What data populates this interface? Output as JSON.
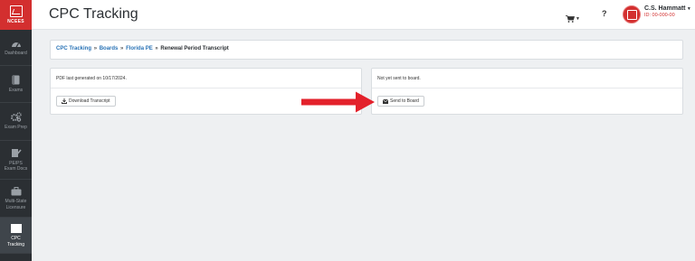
{
  "sidebar": {
    "logo_text": "NCEES",
    "items": [
      {
        "label": "Dashboard",
        "icon": "dashboard-gauge-icon"
      },
      {
        "label": "Exams",
        "icon": "exam-book-icon"
      },
      {
        "label": "Exam Prep",
        "icon": "gears-icon"
      },
      {
        "label": "PE/PS\nExam Docs",
        "icon": "document-pen-icon"
      },
      {
        "label": "Multi-State\nLicensure",
        "icon": "briefcase-icon"
      },
      {
        "label": "CPC\nTracking",
        "icon": "list-table-icon",
        "active": true
      }
    ]
  },
  "header": {
    "title": "CPC Tracking",
    "help": "?",
    "user_name": "C.S. Hammatt",
    "user_id": "ID: 00-000-00"
  },
  "breadcrumb": {
    "items": [
      "CPC Tracking",
      "Boards",
      "Florida PE"
    ],
    "separator": "»",
    "current": "Renewal Period Transcript"
  },
  "left_card": {
    "message": "PDF last generated on 10/17/2024.",
    "button": "Download Transcript"
  },
  "right_card": {
    "message": "Not yet sent to board.",
    "button": "Send to Board"
  },
  "colors": {
    "brand_red": "#d32f2f",
    "sidebar_bg": "#2b2f33",
    "link_blue": "#2a73b6",
    "arrow_red": "#e3212b"
  }
}
